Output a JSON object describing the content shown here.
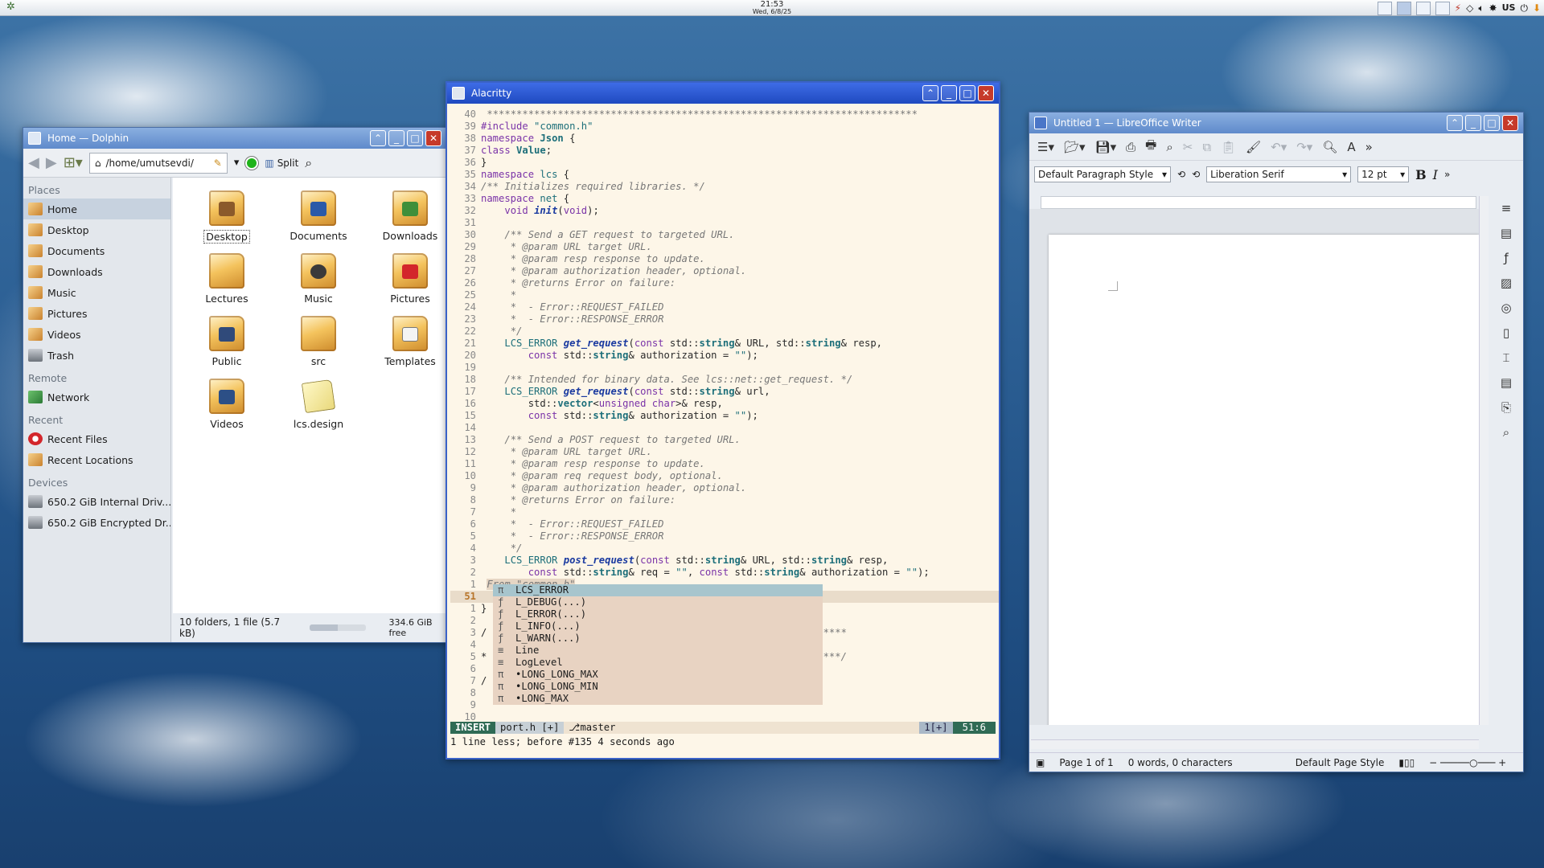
{
  "topbar": {
    "time": "21:53",
    "date": "Wed, 6/8/25",
    "keyboard_layout": "US"
  },
  "dolphin": {
    "title": "Home — Dolphin",
    "path": "/home/umutsevdi/",
    "split_label": "Split",
    "places_header": "Places",
    "places": [
      "Home",
      "Desktop",
      "Documents",
      "Downloads",
      "Music",
      "Pictures",
      "Videos",
      "Trash"
    ],
    "remote_header": "Remote",
    "remote": [
      "Network"
    ],
    "recent_header": "Recent",
    "recent": [
      "Recent Files",
      "Recent Locations"
    ],
    "devices_header": "Devices",
    "devices": [
      "650.2 GiB Internal Driv...",
      "650.2 GiB Encrypted Dr..."
    ],
    "files": [
      "Desktop",
      "Documents",
      "Downloads",
      "Lectures",
      "Music",
      "Pictures",
      "Public",
      "src",
      "Templates",
      "Videos",
      "lcs.design"
    ],
    "status": "10 folders, 1 file (5.7 kB)",
    "free": "334.6 GiB free",
    "disk_used_fraction": 0.49
  },
  "alacritty": {
    "title": "Alacritty",
    "cursor_line": "51",
    "popup_header": "From \"common.h\"",
    "completion_input": "L",
    "completions": [
      {
        "kind": "π",
        "label": "LCS_ERROR"
      },
      {
        "kind": "ƒ",
        "label": "L_DEBUG(...)"
      },
      {
        "kind": "ƒ",
        "label": "L_ERROR(...)"
      },
      {
        "kind": "ƒ",
        "label": "L_INFO(...)"
      },
      {
        "kind": "ƒ",
        "label": "L_WARN(...)"
      },
      {
        "kind": "≡",
        "label": "Line"
      },
      {
        "kind": "≡",
        "label": "LogLevel"
      },
      {
        "kind": "π",
        "label": "•LONG_LONG_MAX"
      },
      {
        "kind": "π",
        "label": "•LONG_LONG_MIN"
      },
      {
        "kind": "π",
        "label": "•LONG_MAX"
      }
    ],
    "status_mode": "INSERT",
    "status_file": "port.h [+]",
    "status_branch": " master",
    "status_buffers": "1[+]",
    "status_pos": "51:6",
    "message": "1 line less; before #135  4 seconds ago"
  },
  "writer": {
    "title": "Untitled 1 — LibreOffice Writer",
    "paragraph_style": "Default Paragraph Style",
    "font_name": "Liberation Serif",
    "font_size": "12 pt",
    "page_info": "Page 1 of 1",
    "word_count": "0 words, 0 characters",
    "page_style": "Default Page Style"
  }
}
